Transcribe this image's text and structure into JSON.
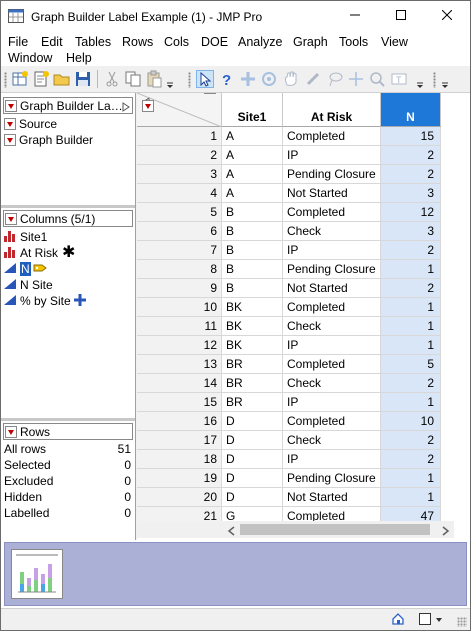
{
  "window": {
    "title": "Graph Builder Label Example (1) - JMP Pro"
  },
  "menu": [
    "File",
    "Edit",
    "Tables",
    "Rows",
    "Cols",
    "DOE",
    "Analyze",
    "Graph",
    "Tools",
    "View",
    "Window",
    "Help"
  ],
  "panels": {
    "table_name": "Graph Builder La…",
    "scripts": [
      "Source",
      "Graph Builder"
    ],
    "columns_header": "Columns (5/1)",
    "columns": [
      {
        "name": "Site1",
        "icon": "nominal-bar-icon"
      },
      {
        "name": "At Risk",
        "icon": "nominal-bar-icon"
      },
      {
        "name": "N",
        "icon": "continuous-triangle-icon"
      },
      {
        "name": "N Site",
        "icon": "continuous-triangle-icon"
      },
      {
        "name": "% by Site",
        "icon": "continuous-triangle-icon"
      }
    ],
    "rows_header": "Rows",
    "row_states": [
      {
        "label": "All rows",
        "value": "51"
      },
      {
        "label": "Selected",
        "value": "0"
      },
      {
        "label": "Excluded",
        "value": "0"
      },
      {
        "label": "Hidden",
        "value": "0"
      },
      {
        "label": "Labelled",
        "value": "0"
      }
    ]
  },
  "table": {
    "headers": [
      "Site1",
      "At Risk",
      "N"
    ],
    "rows": [
      [
        "1",
        "A",
        "Completed",
        "15"
      ],
      [
        "2",
        "A",
        "IP",
        "2"
      ],
      [
        "3",
        "A",
        "Pending Closure",
        "2"
      ],
      [
        "4",
        "A",
        "Not Started",
        "3"
      ],
      [
        "5",
        "B",
        "Completed",
        "12"
      ],
      [
        "6",
        "B",
        "Check",
        "3"
      ],
      [
        "7",
        "B",
        "IP",
        "2"
      ],
      [
        "8",
        "B",
        "Pending Closure",
        "1"
      ],
      [
        "9",
        "B",
        "Not Started",
        "2"
      ],
      [
        "10",
        "BK",
        "Completed",
        "1"
      ],
      [
        "11",
        "BK",
        "Check",
        "1"
      ],
      [
        "12",
        "BK",
        "IP",
        "1"
      ],
      [
        "13",
        "BR",
        "Completed",
        "5"
      ],
      [
        "14",
        "BR",
        "Check",
        "2"
      ],
      [
        "15",
        "BR",
        "IP",
        "1"
      ],
      [
        "16",
        "D",
        "Completed",
        "10"
      ],
      [
        "17",
        "D",
        "Check",
        "2"
      ],
      [
        "18",
        "D",
        "IP",
        "2"
      ],
      [
        "19",
        "D",
        "Pending Closure",
        "1"
      ],
      [
        "20",
        "D",
        "Not Started",
        "1"
      ],
      [
        "21",
        "G",
        "Completed",
        "47"
      ]
    ]
  },
  "colors": {
    "selected_header": "#1e78d7",
    "accent_red": "#c00000"
  }
}
